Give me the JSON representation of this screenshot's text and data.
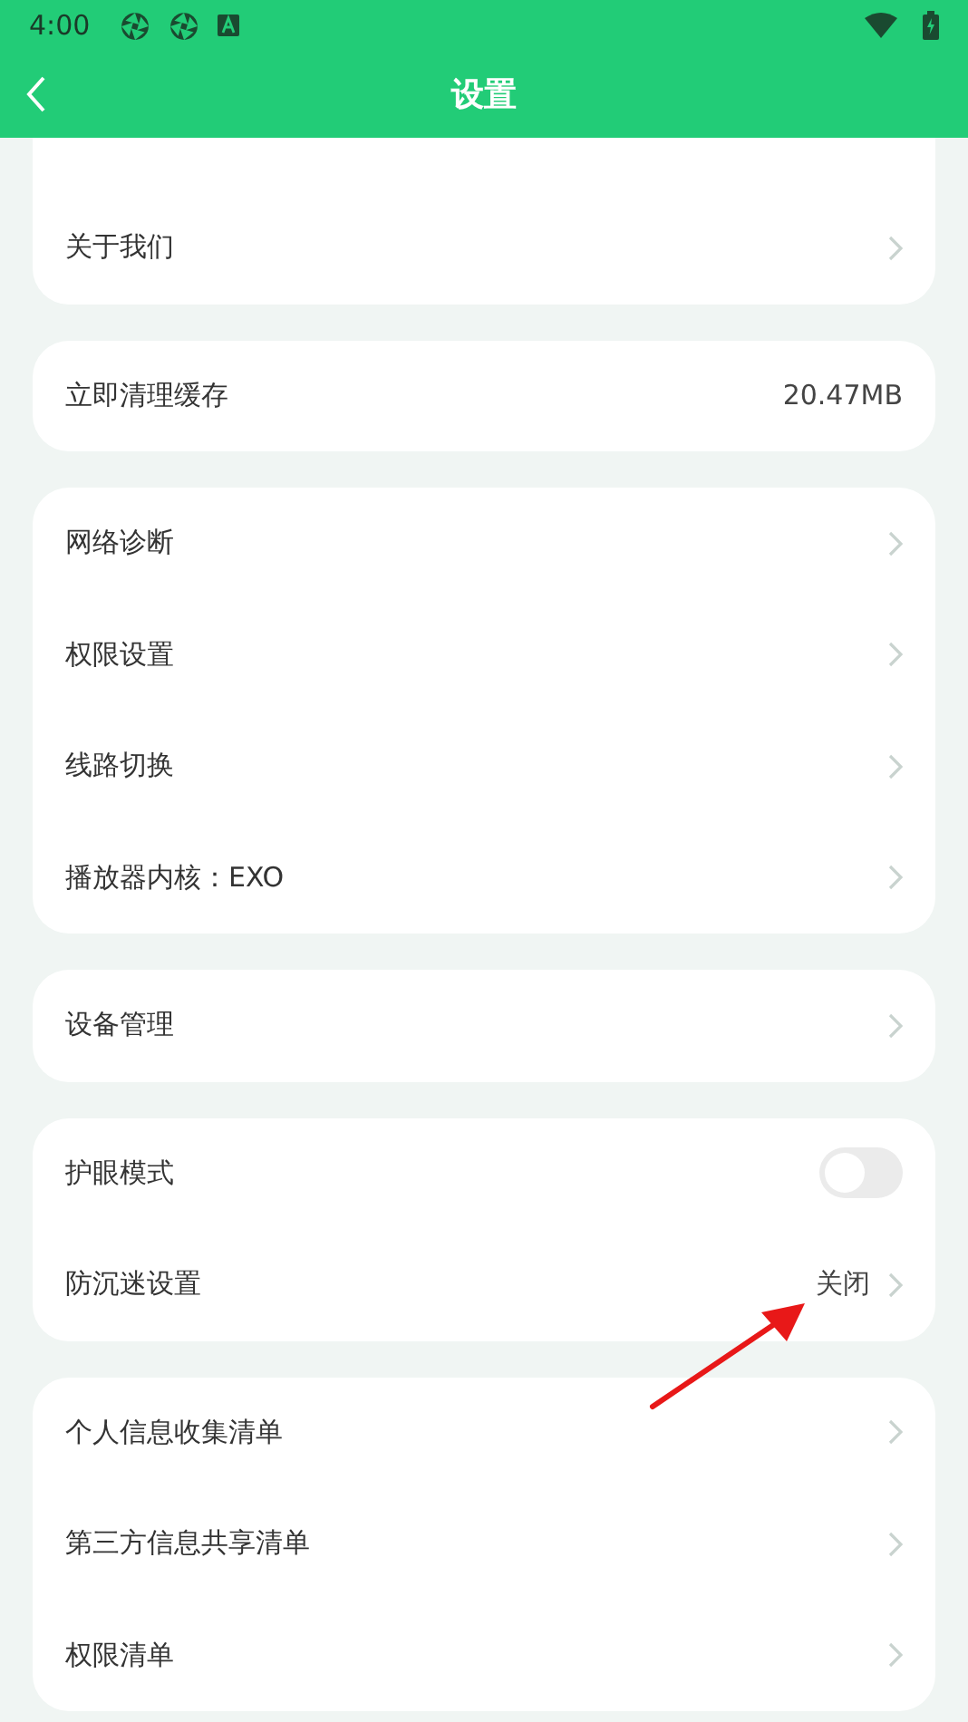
{
  "status_bar": {
    "time": "4:00"
  },
  "header": {
    "title": "设置"
  },
  "groups": [
    {
      "rows": [
        {
          "kind": "link",
          "label": "关于我们"
        }
      ]
    },
    {
      "rows": [
        {
          "kind": "value",
          "label": "立即清理缓存",
          "value": "20.47MB"
        }
      ]
    },
    {
      "rows": [
        {
          "kind": "link",
          "label": "网络诊断"
        },
        {
          "kind": "link",
          "label": "权限设置"
        },
        {
          "kind": "link",
          "label": "线路切换"
        },
        {
          "kind": "link",
          "label": "播放器内核：EXO"
        }
      ]
    },
    {
      "rows": [
        {
          "kind": "link",
          "label": "设备管理"
        }
      ]
    },
    {
      "rows": [
        {
          "kind": "toggle",
          "label": "护眼模式",
          "on": false
        },
        {
          "kind": "link",
          "label": "防沉迷设置",
          "value": "关闭"
        }
      ]
    },
    {
      "rows": [
        {
          "kind": "link",
          "label": "个人信息收集清单"
        },
        {
          "kind": "link",
          "label": "第三方信息共享清单"
        },
        {
          "kind": "link",
          "label": "权限清单"
        }
      ]
    }
  ]
}
